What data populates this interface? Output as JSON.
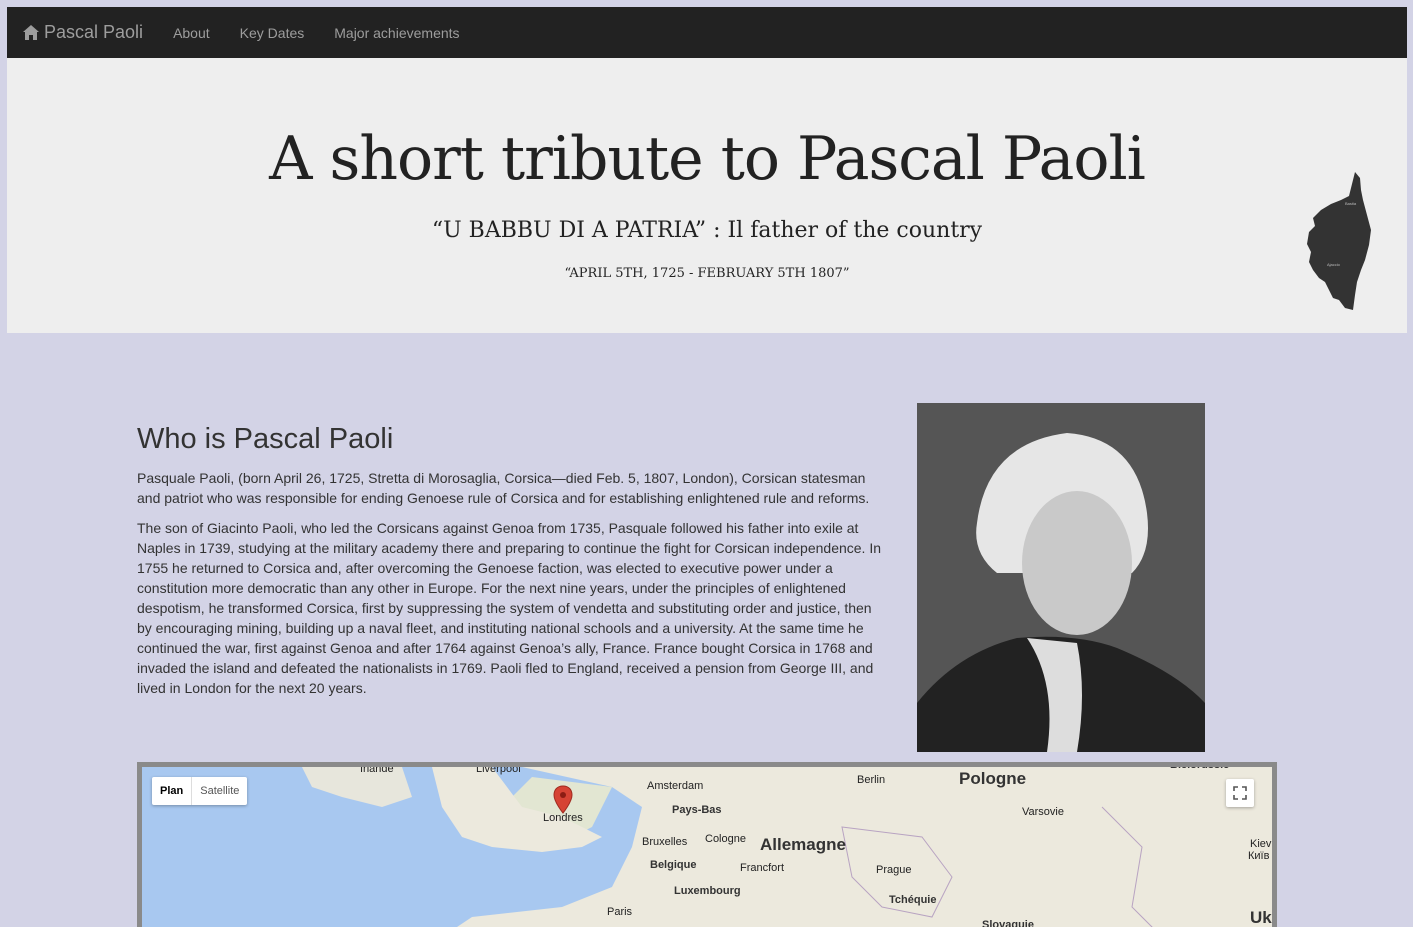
{
  "nav": {
    "brand": "Pascal Paoli",
    "links": [
      "About",
      "Key Dates",
      "Major achievements"
    ]
  },
  "hero": {
    "title": "A short tribute to Pascal Paoli",
    "subtitle": "“U BABBU DI A PATRIA” : Il father of the country",
    "dates": "“APRIL 5TH, 1725 - FEBRUARY 5TH 1807”"
  },
  "about": {
    "heading": "Who is Pascal Paoli",
    "p1": "Pasquale Paoli, (born April 26, 1725, Stretta di Morosaglia, Corsica—died Feb. 5, 1807, London), Corsican statesman and patriot who was responsible for ending Genoese rule of Corsica and for establishing enlightened rule and reforms.",
    "p2": "The son of Giacinto Paoli, who led the Corsicans against Genoa from 1735, Pasquale followed his father into exile at Naples in 1739, studying at the military academy there and preparing to continue the fight for Corsican independence. In 1755 he returned to Corsica and, after overcoming the Genoese faction, was elected to executive power under a constitution more democratic than any other in Europe. For the next nine years, under the principles of enlightened despotism, he transformed Corsica, first by suppressing the system of vendetta and substituting order and justice, then by encouraging mining, building up a naval fleet, and instituting national schools and a university. At the same time he continued the war, first against Genoa and after 1764 against Genoa’s ally, France. France bought Corsica in 1768 and invaded the island and defeated the nationalists in 1769. Paoli fled to England, received a pension from George III, and lived in London for the next 20 years."
  },
  "corsica_map_labels": [
    "Bastia",
    "Ajaccio"
  ],
  "map": {
    "toggle": {
      "plan": "Plan",
      "satellite": "Satellite"
    },
    "labels": {
      "irlande": "Irlande",
      "liverpool": "Liverpool",
      "amsterdam": "Amsterdam",
      "paysbas": "Pays-Bas",
      "berlin": "Berlin",
      "pologne": "Pologne",
      "bielorussie": "Biélorussie",
      "londres": "Londres",
      "varsovie": "Varsovie",
      "bruxelles": "Bruxelles",
      "cologne": "Cologne",
      "allemagne": "Allemagne",
      "belgique": "Belgique",
      "francfort": "Francfort",
      "prague": "Prague",
      "luxembourg": "Luxembourg",
      "tchequie": "Tchéquie",
      "paris": "Paris",
      "kiev": "Kiev",
      "kiev2": "Київ",
      "uk": "Uk",
      "slovaquie": "Slovaquie"
    }
  },
  "colors": {
    "navbar": "#222222",
    "hero": "#eeeeee",
    "page": "#d3d3e6"
  }
}
